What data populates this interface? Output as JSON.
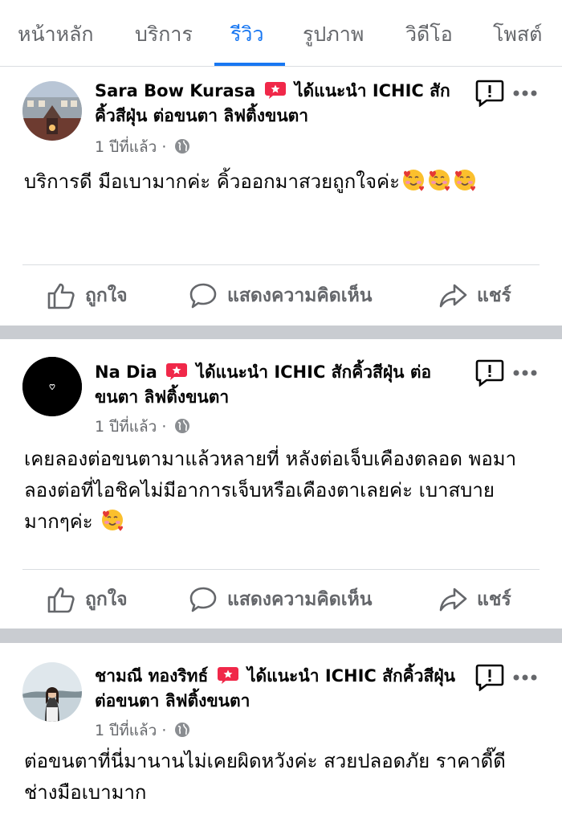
{
  "tabs": [
    "หน้าหลัก",
    "บริการ",
    "รีวิว",
    "รูปภาพ",
    "วิดีโอ",
    "โพสต์"
  ],
  "active_tab": "รีวิว",
  "colors": {
    "accent": "#1877f2",
    "secondary_text": "#65676b",
    "recommend_badge": "#f02849",
    "separator": "#c9ccd1"
  },
  "actions": {
    "like": "ถูกใจ",
    "comment": "แสดงความคิดเห็น",
    "share": "แชร์"
  },
  "posts": [
    {
      "author": "Sara Bow Kurasa",
      "verb": "ได้แนะนำ",
      "page": "ICHIC สักคิ้วสีฝุ่น ต่อขนตา ลิฟติ้งขนตา",
      "time": "1 ปีที่แล้ว",
      "text": "บริการดี มือเบามากค่ะ คิ้วออกมาสวยถูกใจค่ะ",
      "emoji": "smiling-face-with-hearts"
    },
    {
      "author": "Na Dia",
      "verb": "ได้แนะนำ",
      "page": "ICHIC สักคิ้วสีฝุ่น ต่อขนตา ลิฟติ้งขนตา",
      "time": "1 ปีที่แล้ว",
      "text": "เคยลองต่อขนตามาแล้วหลายที่ หลังต่อเจ็บเคืองตลอด พอมาลองต่อที่ไอชิคไม่มีอาการเจ็บหรือเคืองตาเลยค่ะ เบาสบายมากๆค่ะ",
      "emoji": "smiling-face-with-hearts"
    },
    {
      "author": "ชามณี ทองริทธ์",
      "verb": "ได้แนะนำ",
      "page": "ICHIC สักคิ้วสีฝุ่น ต่อขนตา ลิฟติ้งขนตา",
      "time": "1 ปีที่แล้ว",
      "text": "ต่อขนตาที่นี่มานานไม่เคยผิดหวังค่ะ สวยปลอดภัย ราคาดี๊ดี ช่างมือเบามาก"
    }
  ]
}
